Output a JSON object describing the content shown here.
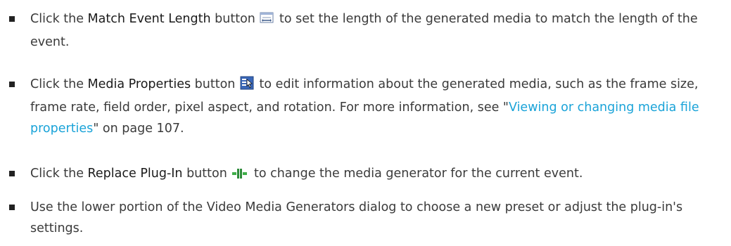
{
  "items": [
    {
      "pre": "Click the ",
      "bold": "Match Event Length",
      "mid": " button",
      "icon": "match-event-length-icon",
      "post": " to set the length of the generated media to match the length of the event."
    },
    {
      "pre": "Click the ",
      "bold": "Media Properties",
      "mid": " button",
      "icon": "media-properties-icon",
      "post": " to edit information about the generated media, such as the frame size, frame rate, field order, pixel aspect, and rotation. For more information, see \"",
      "link": "Viewing or changing media file properties",
      "tail": "\" on page 107."
    },
    {
      "pre": "Click the ",
      "bold": "Replace Plug-In",
      "mid": " button",
      "icon": "replace-plugin-icon",
      "post": " to change the media generator for the current event."
    },
    {
      "text": "Use the lower portion of the Video Media Generators dialog to choose a new preset or adjust the plug-in's settings."
    }
  ],
  "colors": {
    "text": "#3a3a3a",
    "link": "#1aa3d8",
    "bullet": "#222222"
  }
}
